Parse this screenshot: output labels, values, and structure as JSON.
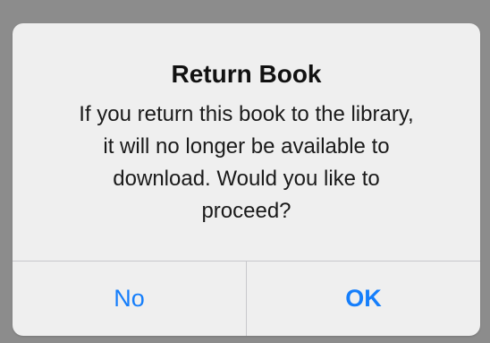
{
  "alert": {
    "title": "Return Book",
    "message": "If you return this book to the library,\nit will no longer be available to\ndownload.  Would you like to\nproceed?",
    "buttons": {
      "cancel_label": "No",
      "confirm_label": "OK"
    }
  },
  "colors": {
    "button_text": "#157efb",
    "alert_background": "#efefef",
    "backdrop": "#8c8c8c"
  }
}
